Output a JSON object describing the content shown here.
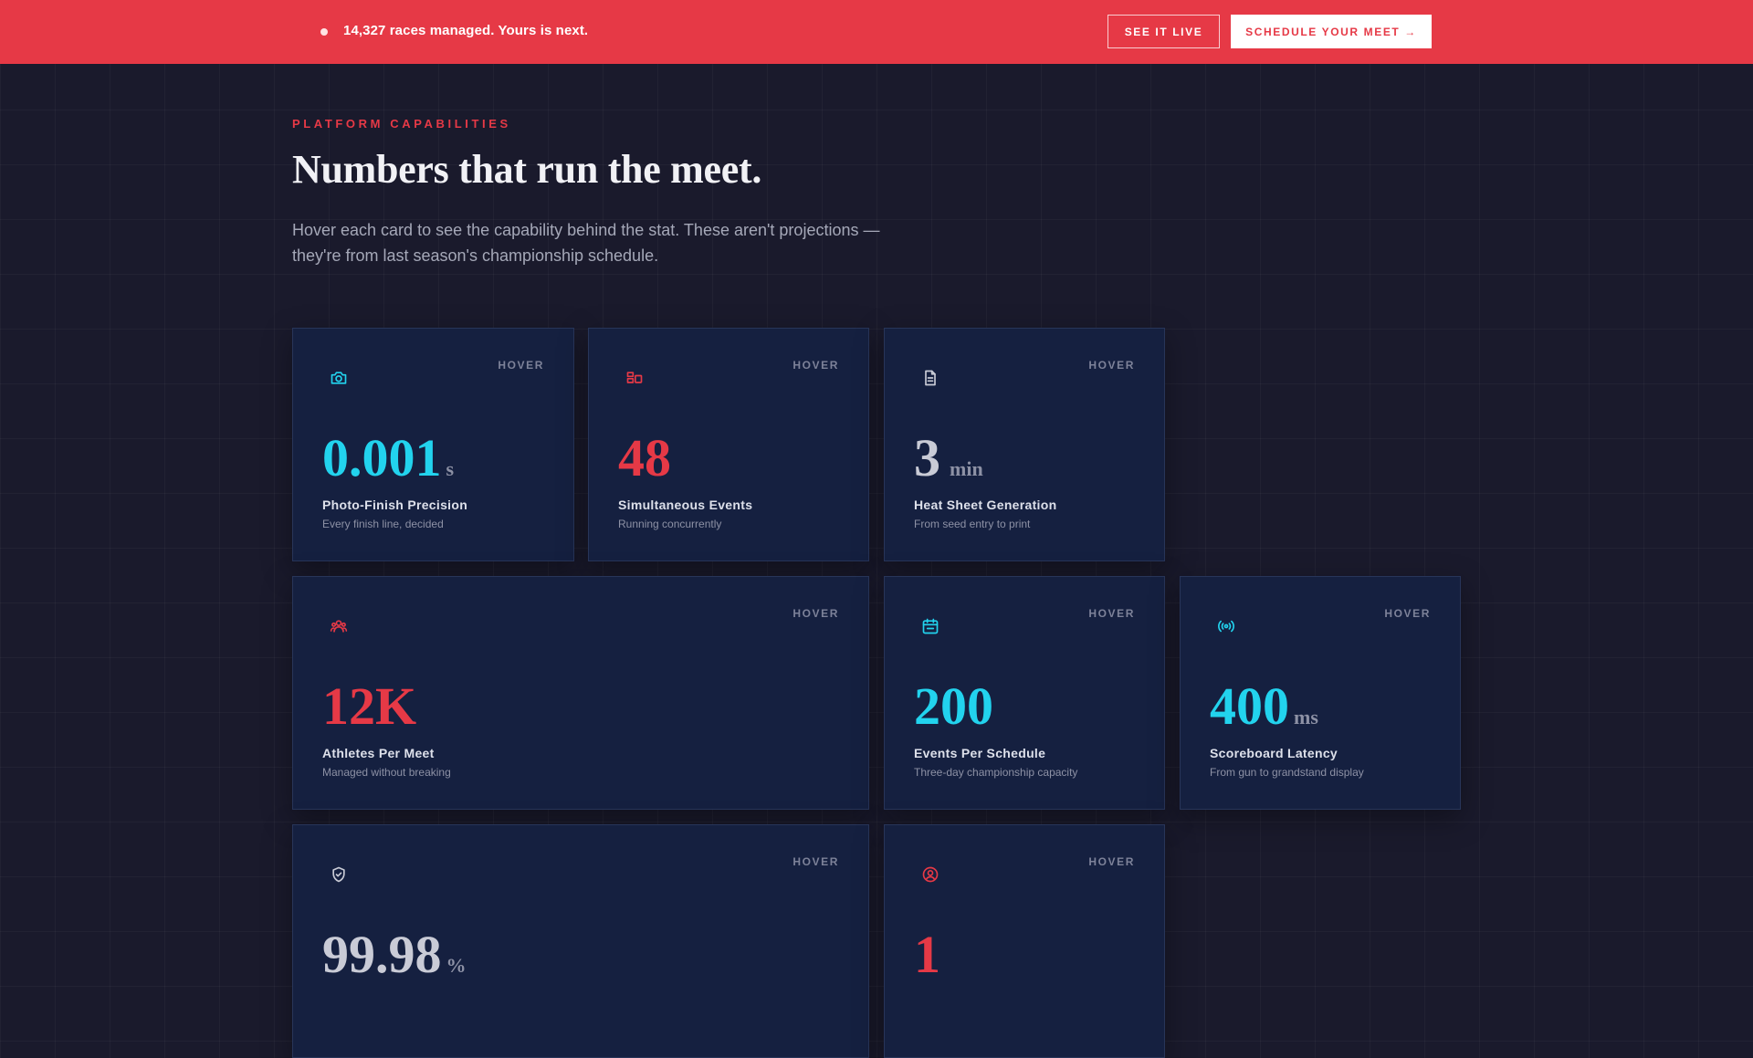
{
  "banner": {
    "message": "14,327 races managed. Yours is next.",
    "see_live_label": "SEE IT LIVE",
    "schedule_label": "SCHEDULE YOUR MEET →"
  },
  "section": {
    "eyebrow": "PLATFORM CAPABILITIES",
    "title": "Numbers that run the meet.",
    "subtitle": "Hover each card to see the capability behind the stat. These aren't projections — they're from last season's championship schedule."
  },
  "colors": {
    "brand_red": "#e63946",
    "accent_cyan": "#22d3ee",
    "neutral_stat": "#c9cbd6"
  },
  "cards": [
    {
      "icon": "camera-icon",
      "hover_label": "HOVER",
      "value": "0.001",
      "unit": "s",
      "label": "Photo-Finish Precision",
      "desc": "Every finish line, decided",
      "accent": "cyan"
    },
    {
      "icon": "events-icon",
      "hover_label": "HOVER",
      "value": "48",
      "unit": "",
      "label": "Simultaneous Events",
      "desc": "Running concurrently",
      "accent": "red"
    },
    {
      "icon": "document-icon",
      "hover_label": "HOVER",
      "value": "3",
      "unit": "min",
      "label": "Heat Sheet Generation",
      "desc": "From seed entry to print",
      "accent": "neutral"
    },
    {
      "icon": "users-icon",
      "hover_label": "HOVER",
      "value": "12K",
      "unit": "",
      "label": "Athletes Per Meet",
      "desc": "Managed without breaking",
      "accent": "red"
    },
    {
      "icon": "calendar-icon",
      "hover_label": "HOVER",
      "value": "200",
      "unit": "",
      "label": "Events Per Schedule",
      "desc": "Three-day championship capacity",
      "accent": "cyan"
    },
    {
      "icon": "broadcast-icon",
      "hover_label": "HOVER",
      "value": "400",
      "unit": "ms",
      "label": "Scoreboard Latency",
      "desc": "From gun to grandstand display",
      "accent": "cyan"
    },
    {
      "icon": "shield-check-icon",
      "hover_label": "HOVER",
      "value": "99.98",
      "unit": "%",
      "label": "",
      "desc": "",
      "accent": "neutral"
    },
    {
      "icon": "user-circle-icon",
      "hover_label": "HOVER",
      "value": "1",
      "unit": "",
      "label": "",
      "desc": "",
      "accent": "red"
    }
  ]
}
